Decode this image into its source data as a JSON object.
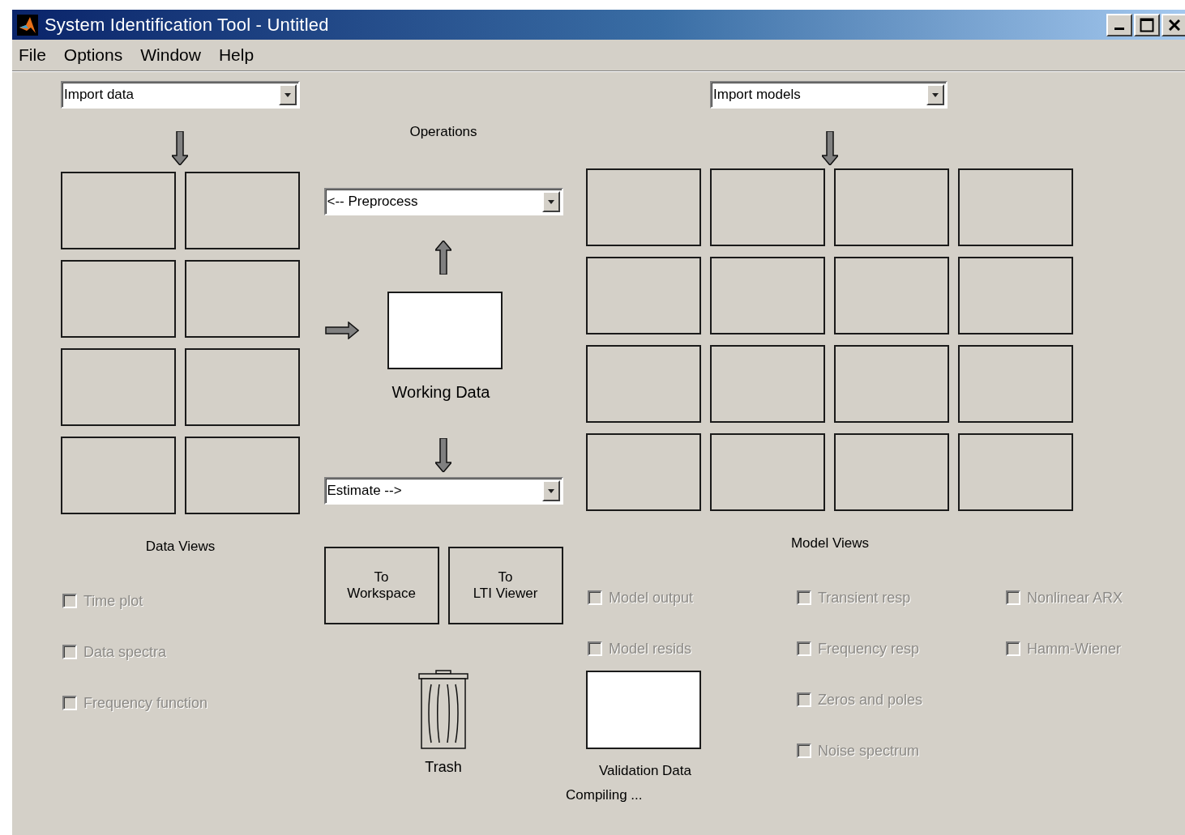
{
  "window": {
    "title": "System Identification Tool - Untitled"
  },
  "menu": [
    {
      "label": "File"
    },
    {
      "label": "Options"
    },
    {
      "label": "Window"
    },
    {
      "label": "Help"
    }
  ],
  "data_panel": {
    "import_dropdown": {
      "value": "Import data"
    },
    "label": "Data Views",
    "views": [
      {
        "label": "Time plot",
        "checked": false,
        "disabled": true
      },
      {
        "label": "Data spectra",
        "checked": false,
        "disabled": true
      },
      {
        "label": "Frequency function",
        "checked": false,
        "disabled": true
      }
    ]
  },
  "operations": {
    "title": "Operations",
    "preprocess": {
      "value": "<-- Preprocess"
    },
    "working_data": {
      "label": "Working Data"
    },
    "estimate": {
      "value": "Estimate -->"
    },
    "buttons": [
      {
        "label": "To\nWorkspace"
      },
      {
        "label": "To\nLTI Viewer"
      }
    ],
    "trash": {
      "label": "Trash"
    }
  },
  "model_panel": {
    "import_dropdown": {
      "value": "Import models"
    },
    "label": "Model Views",
    "view_columns": [
      [
        {
          "label": "Model output",
          "checked": false,
          "disabled": true
        },
        {
          "label": "Model resids",
          "checked": false,
          "disabled": true
        }
      ],
      [
        {
          "label": "Transient resp",
          "checked": false,
          "disabled": true
        },
        {
          "label": "Frequency resp",
          "checked": false,
          "disabled": true
        },
        {
          "label": "Zeros and poles",
          "checked": false,
          "disabled": true
        },
        {
          "label": "Noise spectrum",
          "checked": false,
          "disabled": true
        }
      ],
      [
        {
          "label": "Nonlinear ARX",
          "checked": false,
          "disabled": true
        },
        {
          "label": "Hamm-Wiener",
          "checked": false,
          "disabled": true
        }
      ]
    ],
    "validation_data": {
      "label": "Validation Data"
    }
  },
  "status": "Compiling ..."
}
